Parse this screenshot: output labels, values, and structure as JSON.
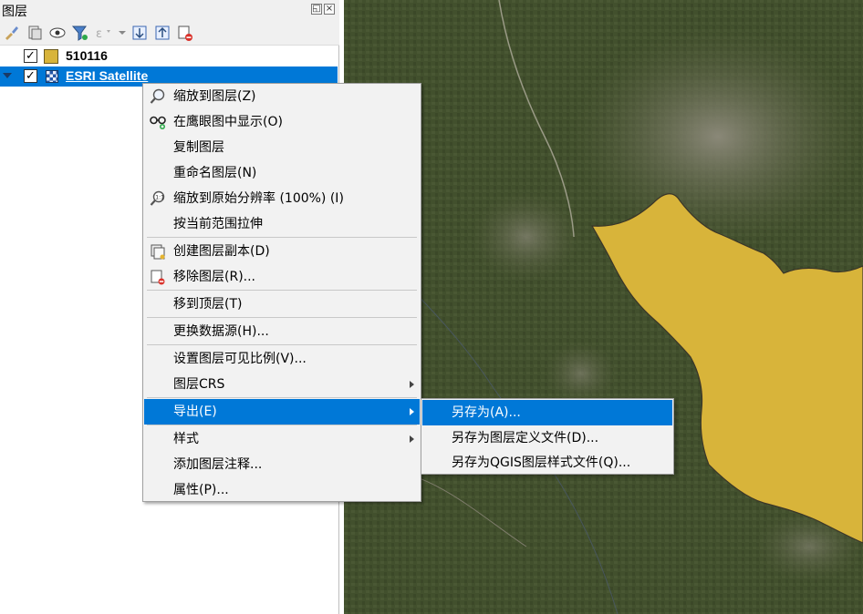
{
  "panel": {
    "title": "图层",
    "float_btn": "◱",
    "close_btn": "×"
  },
  "toolbar": {
    "icons": [
      "style-brush-icon",
      "add-group-icon",
      "visibility-eye-icon",
      "filter-funnel-icon",
      "filter-expression-icon",
      "expand-all-icon",
      "collapse-all-icon",
      "remove-layer-icon"
    ]
  },
  "layers": [
    {
      "name": "510116",
      "checked": "✓",
      "type": "vector",
      "color": "#d8b43a"
    },
    {
      "name": "ESRI Satellite",
      "checked": "✓",
      "type": "raster",
      "selected": true
    }
  ],
  "context_menu": {
    "items": [
      {
        "label": "缩放到图层(Z)",
        "icon": "zoom-to-layer-icon"
      },
      {
        "label": "在鹰眼图中显示(O)",
        "icon": "overview-glasses-icon"
      },
      {
        "label": "复制图层"
      },
      {
        "label": "重命名图层(N)"
      },
      {
        "label": "缩放到原始分辨率 (100%) (I)",
        "icon": "zoom-native-icon"
      },
      {
        "label": "按当前范围拉伸"
      },
      {
        "label": "创建图层副本(D)",
        "icon": "duplicate-layer-icon"
      },
      {
        "label": "移除图层(R)...",
        "icon": "remove-layer-icon"
      },
      {
        "label": "移到顶层(T)"
      },
      {
        "label": "更换数据源(H)..."
      },
      {
        "label": "设置图层可见比例(V)..."
      },
      {
        "label": "图层CRS"
      },
      {
        "label": "导出(E)"
      },
      {
        "label": "样式"
      },
      {
        "label": "添加图层注释..."
      },
      {
        "label": "属性(P)..."
      }
    ]
  },
  "export_submenu": {
    "items": [
      {
        "label": "另存为(A)..."
      },
      {
        "label": "另存为图层定义文件(D)..."
      },
      {
        "label": "另存为QGIS图层样式文件(Q)..."
      }
    ]
  },
  "colors": {
    "accent": "#0078d7",
    "polygon_fill": "#d8b43a",
    "menu_bg": "#f2f2f2"
  }
}
